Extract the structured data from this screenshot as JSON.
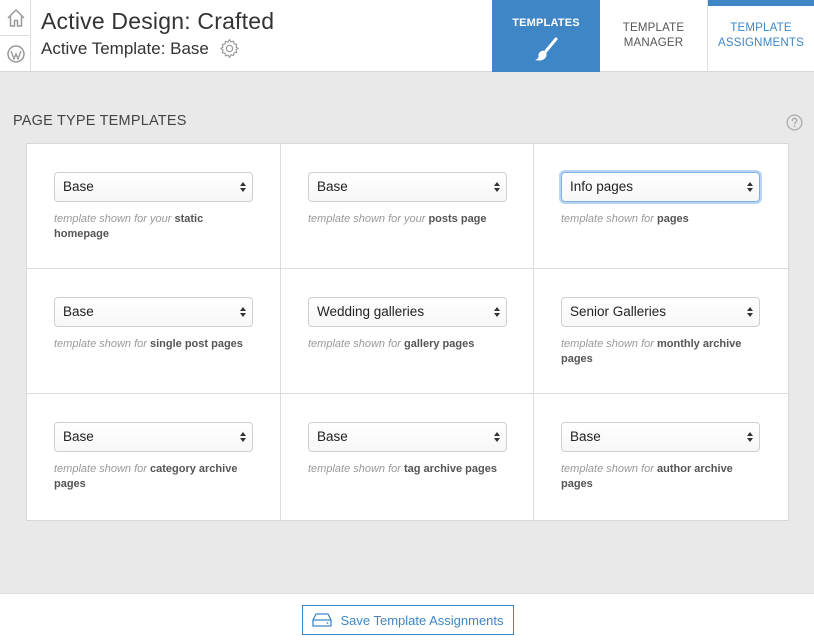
{
  "header": {
    "design_title": "Active Design: Crafted",
    "template_line": "Active Template: Base"
  },
  "tabs": {
    "templates": "TEMPLATES",
    "manager_line1": "TEMPLATE",
    "manager_line2": "MANAGER",
    "assignments_line1": "TEMPLATE",
    "assignments_line2": "ASSIGNMENTS"
  },
  "section": {
    "title": "PAGE TYPE TEMPLATES"
  },
  "cells": [
    {
      "selected": "Base",
      "prefix": "template shown for your",
      "target": "static homepage",
      "focused": false
    },
    {
      "selected": "Base",
      "prefix": "template shown for your",
      "target": "posts page",
      "focused": false
    },
    {
      "selected": "Info pages",
      "prefix": "template shown for",
      "target": "pages",
      "focused": true
    },
    {
      "selected": "Base",
      "prefix": "template shown for",
      "target": "single post pages",
      "focused": false
    },
    {
      "selected": "Wedding galleries",
      "prefix": "template shown for",
      "target": "gallery pages",
      "focused": false
    },
    {
      "selected": "Senior Galleries",
      "prefix": "template shown for",
      "target": "monthly archive pages",
      "focused": false
    },
    {
      "selected": "Base",
      "prefix": "template shown for",
      "target": "category archive pages",
      "focused": false
    },
    {
      "selected": "Base",
      "prefix": "template shown for",
      "target": "tag archive pages",
      "focused": false
    },
    {
      "selected": "Base",
      "prefix": "template shown for",
      "target": "author archive pages",
      "focused": false
    }
  ],
  "footer": {
    "save_label": "Save Template Assignments"
  },
  "icons": {
    "home": "home-icon",
    "wordpress": "wordpress-icon",
    "gear": "gear-icon",
    "brush": "paintbrush-icon",
    "help": "help-icon",
    "save": "drive-icon"
  },
  "colors": {
    "accent": "#3e86c6",
    "background": "#e9e9e9"
  }
}
